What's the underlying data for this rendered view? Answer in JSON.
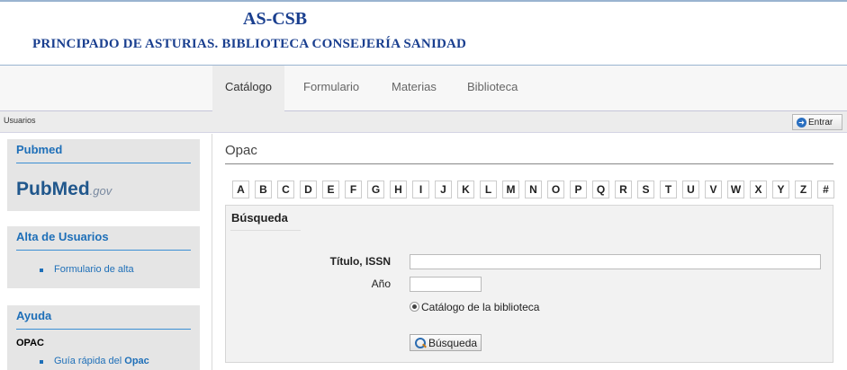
{
  "header": {
    "title": "AS-CSB",
    "subtitle": "PRINCIPADO DE ASTURIAS. BIBLIOTECA CONSEJERÍA SANIDAD"
  },
  "nav": {
    "items": [
      {
        "label": "Catálogo",
        "active": true
      },
      {
        "label": "Formulario",
        "active": false
      },
      {
        "label": "Materias",
        "active": false
      },
      {
        "label": "Biblioteca",
        "active": false
      }
    ]
  },
  "userbar": {
    "label": "Usuarios",
    "login_button": "Entrar"
  },
  "sidebar": {
    "pubmed": {
      "title": "Pubmed",
      "logo_main": "PubMed",
      "logo_suffix": ".gov"
    },
    "alta": {
      "title": "Alta de Usuarios",
      "link": "Formulario de alta"
    },
    "ayuda": {
      "title": "Ayuda",
      "section": "OPAC",
      "link_prefix": "Guía rápida del ",
      "link_bold": "Opac"
    }
  },
  "main": {
    "title": "Opac",
    "letters": [
      "A",
      "B",
      "C",
      "D",
      "E",
      "F",
      "G",
      "H",
      "I",
      "J",
      "K",
      "L",
      "M",
      "N",
      "O",
      "P",
      "Q",
      "R",
      "S",
      "T",
      "U",
      "V",
      "W",
      "X",
      "Y",
      "Z",
      "#"
    ],
    "search": {
      "heading": "Búsqueda",
      "title_label": "Título, ISSN",
      "title_value": "",
      "year_label": "Año",
      "year_value": "",
      "radio_label": "Catálogo de la biblioteca",
      "radio_checked": true,
      "button": "Búsqueda"
    }
  },
  "colors": {
    "brand_blue": "#1a3f8f",
    "link_blue": "#1e6fb8"
  }
}
